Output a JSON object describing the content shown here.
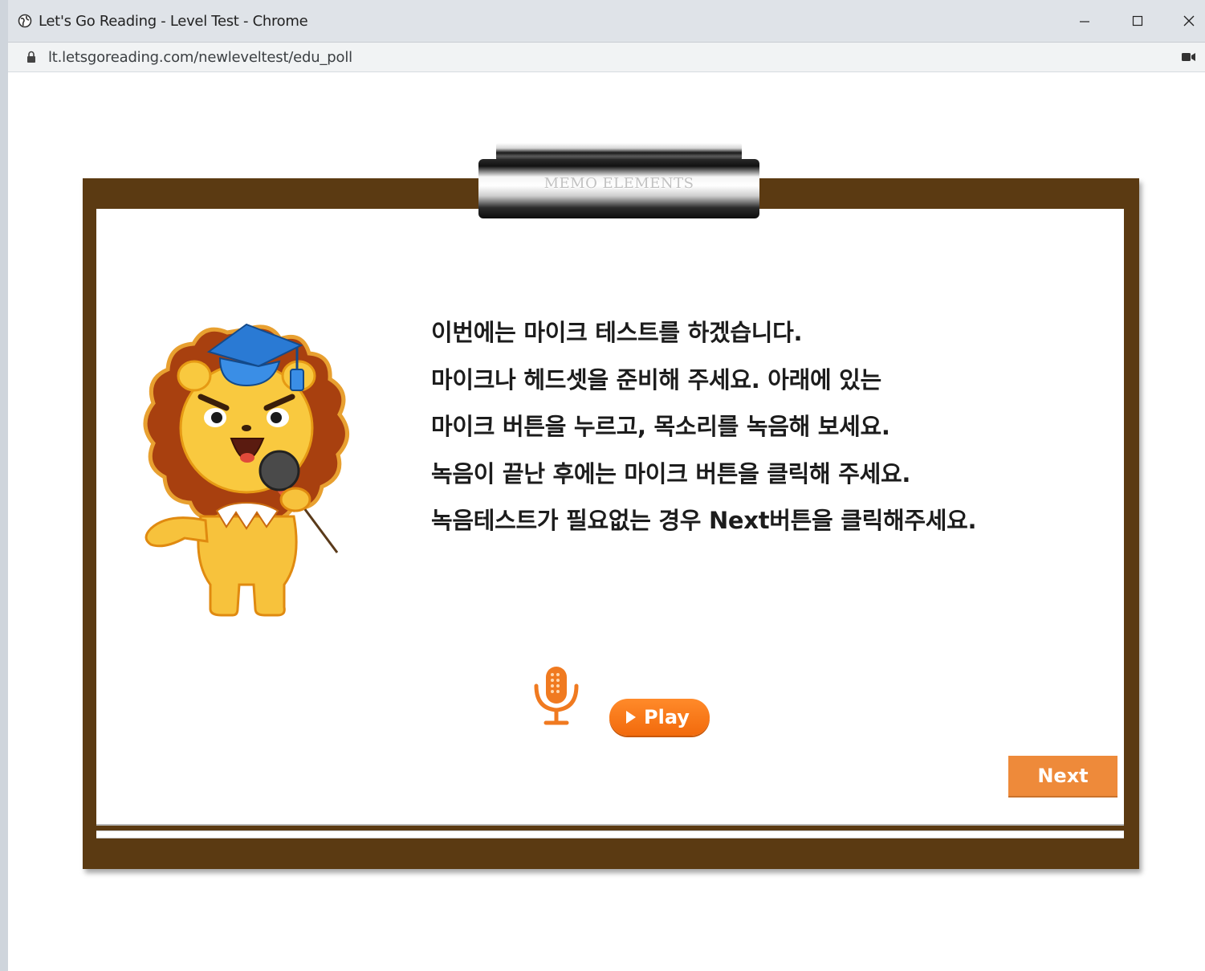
{
  "window": {
    "title": "Let's Go Reading - Level Test - Chrome",
    "url": "lt.letsgoreading.com/newleveltest/edu_poll"
  },
  "clipboard": {
    "label": "MEMO ELEMENTS"
  },
  "instructions": [
    "이번에는 마이크 테스트를 하겠습니다.",
    "마이크나 헤드셋을 준비해 주세요. 아래에 있는",
    "마이크 버튼을 누르고, 목소리를 녹음해 보세요.",
    "녹음이 끝난 후에는 마이크 버튼을 클릭해 주세요.",
    "녹음테스트가 필요없는 경우 Next버튼을 클릭해주세요."
  ],
  "controls": {
    "play_label": "Play",
    "next_label": "Next"
  },
  "colors": {
    "board": "#5b3a12",
    "accent_orange": "#f26a0c",
    "next_orange": "#ee8a3a"
  },
  "icons": {
    "mascot": "lion-mascot",
    "mic": "microphone-icon"
  }
}
